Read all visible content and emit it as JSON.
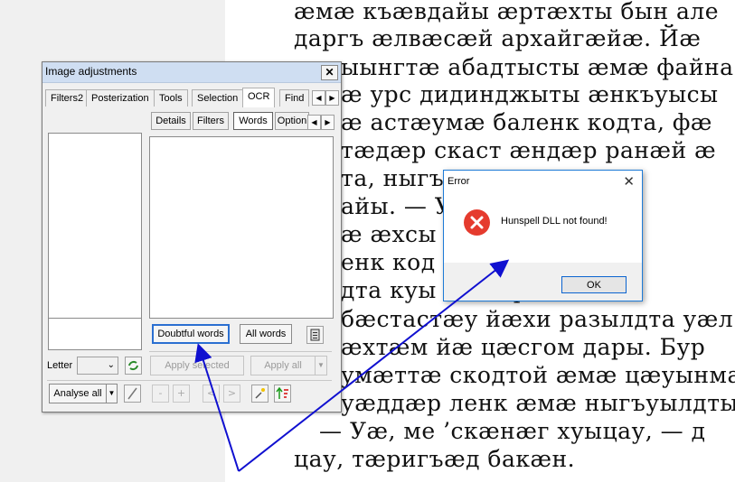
{
  "document": {
    "lines": [
      "æмæ къæвдайы æртæхты бын але",
      "даргъ æлвæсæй архайгæйæ. Йæ",
      "ыынгтæ абадтысты æмæ файна",
      "æ урс дидинджыты æнкъуысы",
      "æ астæумæ баленк кодта, фæ",
      "тæдæр скаст æндæр ранæй æ",
      "та, ныгъ             ы, доны",
      "айы. — У             хуыцау",
      "æ æхсы             — Уæ,",
      "енк код             размæ,",
      "дта куы             æ та ф",
      "бæстастæу йæхи разылдта уæл",
      "æхтæм йæ цæсгом дары. Бур",
      "умæттæ скодтой æмæ цæуынма",
      "уæддæр ленк æмæ ныгъуылдтыта",
      "  — Уæ, ме ’скæнæг хуыцау, — д",
      "цау, тæригъæд бакæн."
    ]
  },
  "panel": {
    "title": "Image adjustments",
    "close": "✕",
    "tabs": [
      "Filters2",
      "Posterization",
      "Tools",
      "Selection",
      "OCR",
      "Find"
    ],
    "active_tab": "OCR",
    "scroll_left": "◀",
    "scroll_right": "▶",
    "subtabs": [
      "Details",
      "Filters",
      "Words",
      "Option"
    ],
    "active_subtab": "Words",
    "doubtful_words": "Doubtful words",
    "all_words": "All words",
    "letter_label": "Letter",
    "apply_selected": "Apply selected",
    "apply_all": "Apply all",
    "analyse_all": "Analyse all",
    "minus": "-",
    "plus": "+",
    "prev": "<",
    "next": ">"
  },
  "error_dialog": {
    "title": "Error",
    "close": "✕",
    "message": "Hunspell DLL not found!",
    "ok": "OK"
  }
}
